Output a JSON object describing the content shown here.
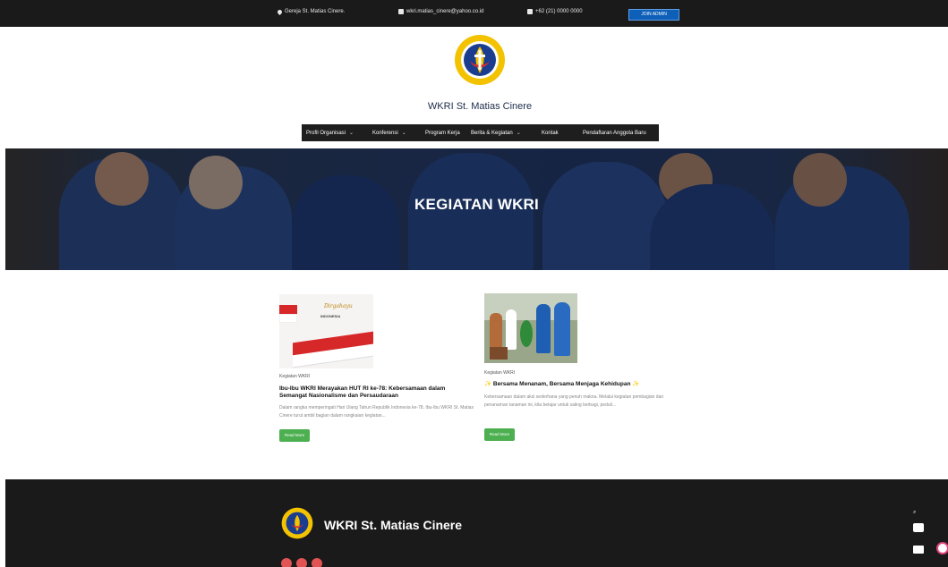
{
  "topbar": {
    "address": "Gereja St. Matias Cinere.",
    "email": "wkri.matias_cinere@yahoo.co.id",
    "phone": "+62 (21) 0000 0000",
    "join_label": "JOIN ADMIN"
  },
  "header": {
    "site_title": "WKRI St. Matias Cinere"
  },
  "nav": {
    "items": [
      {
        "label": "Profil Organisasi",
        "has_caret": true
      },
      {
        "label": "Konferensi",
        "has_caret": true
      },
      {
        "label": "Program Kerja",
        "has_caret": false
      },
      {
        "label": "Berita & Kegiatan",
        "has_caret": true
      },
      {
        "label": "Kontak",
        "has_caret": false
      },
      {
        "label": "Pendaftaran Anggota Baru",
        "has_caret": false
      }
    ]
  },
  "hero": {
    "title": "KEGIATAN WKRI"
  },
  "posts": [
    {
      "category": "Kegiatan WKRI",
      "title": "Ibu-Ibu WKRI Merayakan HUT RI ke-78: Kebersamaan dalam Semangat Nasionalisme dan Persaudaraan",
      "excerpt": "Dalam rangka memperingati Hari Ulang Tahun Republik Indonesia ke-78, Ibu-Ibu WKRI St. Matias Cinere turut ambil bagian dalam rangkaian kegiatan...",
      "read_more": "Read More",
      "thumb_text_1": "Dirgahayu",
      "thumb_text_2": "INDONESIA"
    },
    {
      "category": "Kegiatan WKRI",
      "title": "✨ Bersama Menanam, Bersama Menjaga Kehidupan ✨",
      "excerpt": "Kebersamaan dalam aksi sederhana yang penuh makna. Melalui kegiatan pembagian dan penanaman tanaman ini, kita belajar untuk saling berbagi, peduli...",
      "read_more": "Read More"
    }
  ],
  "footer": {
    "title": "WKRI St. Matias Cinere"
  },
  "colors": {
    "topbar_bg": "#1a1a1a",
    "join_button": "#0d5fb8",
    "read_more": "#4caf50",
    "footer_bg": "#1a1a1a"
  },
  "icons": {
    "address": "location-pin-icon",
    "email": "mail-icon",
    "phone": "phone-icon"
  }
}
